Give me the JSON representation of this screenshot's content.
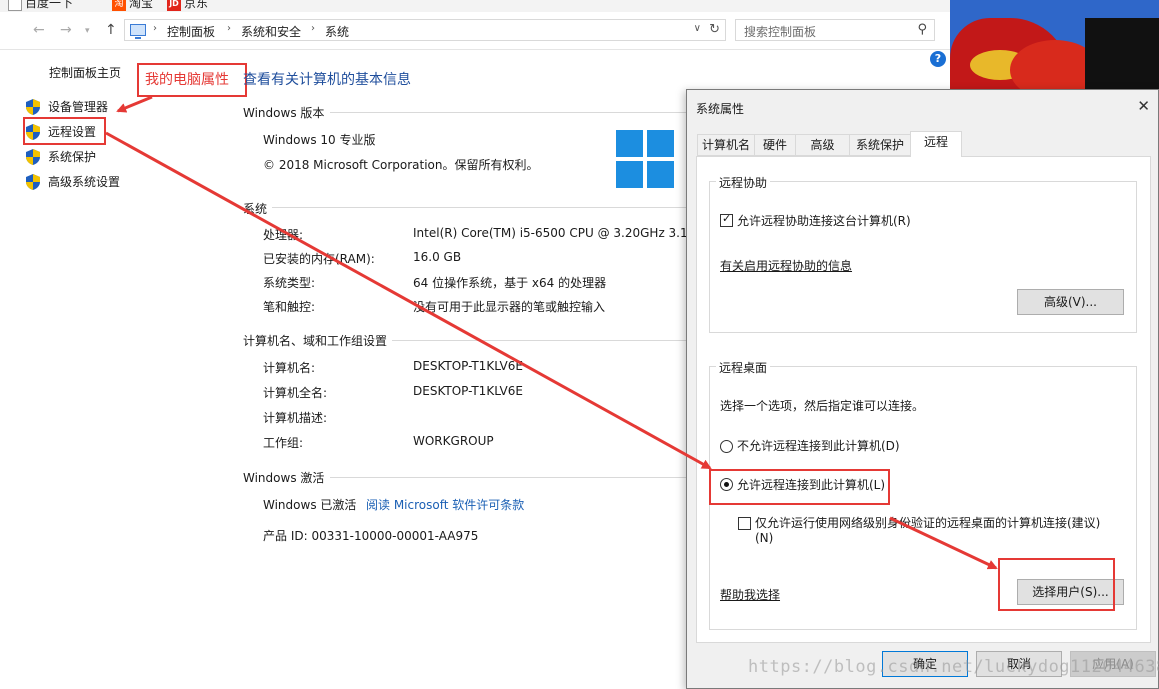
{
  "bookmarks": [
    "百度一下",
    "淘宝",
    "京东"
  ],
  "address": {
    "crumbs": [
      "控制面板",
      "系统和安全",
      "系统"
    ],
    "search_placeholder": "搜索控制面板"
  },
  "left_panel": {
    "home": "控制面板主页",
    "items": [
      "设备管理器",
      "远程设置",
      "系统保护",
      "高级系统设置"
    ]
  },
  "annotation": "我的电脑属性",
  "page_title": "查看有关计算机的基本信息",
  "edition": {
    "heading": "Windows 版本",
    "name": "Windows 10 专业版",
    "copyright": "© 2018 Microsoft Corporation。保留所有权利。"
  },
  "system": {
    "heading": "系统",
    "rows": [
      {
        "label": "处理器:",
        "value": "Intel(R) Core(TM) i5-6500 CPU @ 3.20GHz   3.1"
      },
      {
        "label": "已安装的内存(RAM):",
        "value": "16.0 GB"
      },
      {
        "label": "系统类型:",
        "value": "64 位操作系统，基于 x64 的处理器"
      },
      {
        "label": "笔和触控:",
        "value": "没有可用于此显示器的笔或触控输入"
      }
    ]
  },
  "computer": {
    "heading": "计算机名、域和工作组设置",
    "rows": [
      {
        "label": "计算机名:",
        "value": "DESKTOP-T1KLV6E"
      },
      {
        "label": "计算机全名:",
        "value": "DESKTOP-T1KLV6E"
      },
      {
        "label": "计算机描述:",
        "value": ""
      },
      {
        "label": "工作组:",
        "value": "WORKGROUP"
      }
    ]
  },
  "activation": {
    "heading": "Windows 激活",
    "status": "Windows 已激活",
    "link": "阅读 Microsoft 软件许可条款",
    "product_id": "产品 ID: 00331-10000-00001-AA975"
  },
  "dialog": {
    "title": "系统属性",
    "close": "✕",
    "tabs": [
      "计算机名",
      "硬件",
      "高级",
      "系统保护",
      "远程"
    ],
    "assist": {
      "group": "远程协助",
      "allow": "允许远程协助连接这台计算机(R)",
      "info_link": "有关启用远程协助的信息",
      "advanced_btn": "高级(V)..."
    },
    "desktop": {
      "group": "远程桌面",
      "intro": "选择一个选项，然后指定谁可以连接。",
      "deny": "不允许远程连接到此计算机(D)",
      "allow": "允许远程连接到此计算机(L)",
      "nla_line1": "仅允许运行使用网络级别身份验证的远程桌面的计算机连接(建议)",
      "nla_line2": "(N)",
      "help_link": "帮助我选择",
      "select_users_btn": "选择用户(S)..."
    },
    "buttons": {
      "ok": "确定",
      "cancel": "取消",
      "apply": "应用(A)"
    }
  },
  "watermark": "https://blog.csdn.net/luckydog1120446388"
}
